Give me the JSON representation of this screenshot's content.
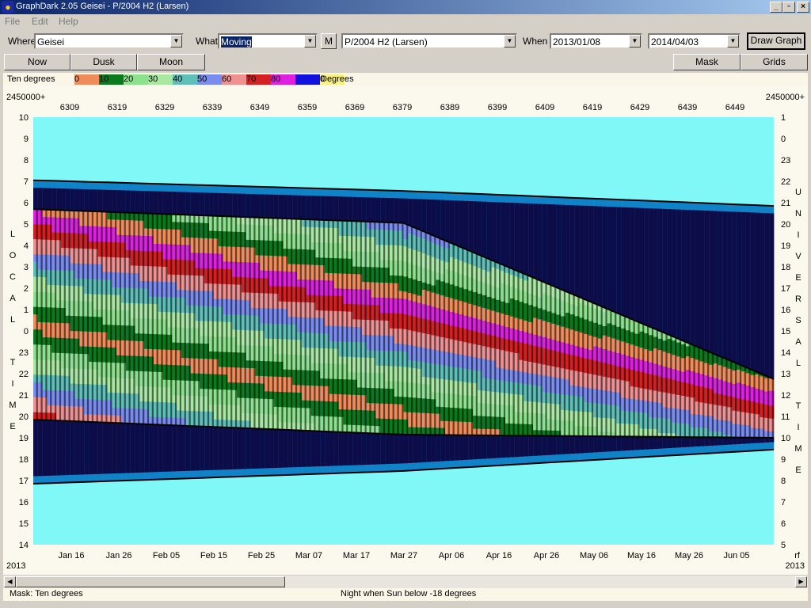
{
  "window": {
    "title": "GraphDark 2.05   Geisei   -   P/2004 H2 (Larsen)",
    "app_icon": "owl-icon",
    "controls": [
      "_",
      "▫",
      "×"
    ]
  },
  "menu": [
    "File",
    "Edit",
    "Help"
  ],
  "toolbar": {
    "where_label": "Where",
    "where_value": "Geisei",
    "what_label": "What",
    "what_value": "Moving",
    "m_button": "M",
    "object_value": "P/2004 H2 (Larsen)",
    "when_label": "When",
    "date_start": "2013/01/08",
    "date_end": "2014/04/03",
    "draw_button": "Draw Graph"
  },
  "buttons": {
    "now": "Now",
    "dusk": "Dusk",
    "moon": "Moon",
    "mask": "Mask",
    "grids": "Grids"
  },
  "legend": {
    "label": "Ten degrees",
    "unit": "Degrees",
    "items": [
      {
        "text": "0",
        "color": "#f08c5a"
      },
      {
        "text": "10",
        "color": "#0b7a1c"
      },
      {
        "text": "20",
        "color": "#8ce28c"
      },
      {
        "text": "30",
        "color": "#a8e8a0"
      },
      {
        "text": "40",
        "color": "#5ec0b8"
      },
      {
        "text": "50",
        "color": "#7a8cf0"
      },
      {
        "text": "60",
        "color": "#f09090"
      },
      {
        "text": "70",
        "color": "#d42020"
      },
      {
        "text": "80",
        "color": "#e020e0"
      },
      {
        "text": "",
        "color": "#1010e0"
      },
      {
        "text": "0",
        "color": "#f8f080"
      }
    ]
  },
  "chart_data": {
    "type": "heatmap",
    "top_left_label": "2450000+",
    "top_right_label": "2450000+",
    "jd_ticks": [
      "6309",
      "6319",
      "6329",
      "6339",
      "6349",
      "6359",
      "6369",
      "6379",
      "6389",
      "6399",
      "6409",
      "6419",
      "6429",
      "6439",
      "6449"
    ],
    "date_ticks": [
      "Jan 16",
      "Jan 26",
      "Feb 05",
      "Feb 15",
      "Feb 25",
      "Mar 07",
      "Mar 17",
      "Mar 27",
      "Apr 06",
      "Apr 16",
      "Apr 26",
      "May 06",
      "May 16",
      "May 26",
      "Jun 05"
    ],
    "left_axis_title": [
      "L",
      "O",
      "C",
      "A",
      "L",
      "",
      "T",
      "I",
      "M",
      "E"
    ],
    "left_axis_ticks": [
      "10",
      "9",
      "8",
      "7",
      "6",
      "5",
      "4",
      "3",
      "2",
      "1",
      "0",
      "23",
      "22",
      "21",
      "20",
      "19",
      "18",
      "17",
      "16",
      "15",
      "14"
    ],
    "right_axis_ticks": [
      "1",
      "0",
      "23",
      "22",
      "21",
      "20",
      "19",
      "18",
      "17",
      "16",
      "15",
      "14",
      "13",
      "12",
      "11",
      "10",
      "9",
      "8",
      "7",
      "6",
      "5"
    ],
    "right_axis_title": [
      "U",
      "N",
      "I",
      "V",
      "E",
      "R",
      "S",
      "A",
      "L",
      "",
      "T",
      "I",
      "M",
      "E"
    ],
    "year_left": "2013",
    "year_right": "2013",
    "right_corner": "rf",
    "night_start_local": [
      [
        0,
        7.05
      ],
      [
        0.5,
        6.55
      ],
      [
        1,
        5.85
      ]
    ],
    "night_end_local": [
      [
        0,
        -7.15
      ],
      [
        0.5,
        -6.55
      ],
      [
        1,
        -5.55
      ]
    ],
    "object_rise_local": [
      [
        0,
        5.7
      ],
      [
        0.5,
        5.05
      ],
      [
        1,
        -2.25
      ]
    ],
    "object_set_local": [
      [
        0,
        -4.15
      ],
      [
        0.5,
        -4.85
      ],
      [
        1,
        -5.0
      ]
    ],
    "colors": {
      "background": "#80f8f8",
      "night_sky": "#0c0c48",
      "twilight_deep": "#1082c8",
      "twilight_light": "#c0ccd8"
    }
  },
  "status": {
    "mask": "Mask:  Ten degrees",
    "night": "Night when Sun below -18 degrees"
  }
}
